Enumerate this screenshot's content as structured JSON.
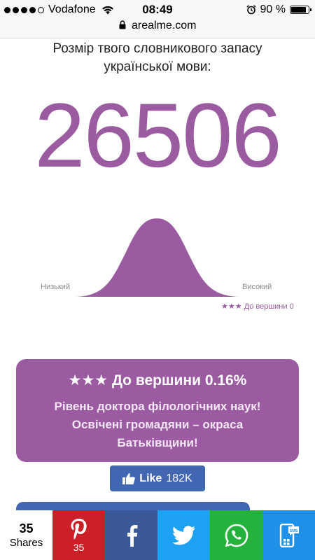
{
  "status_bar": {
    "carrier": "Vodafone",
    "time": "08:49",
    "battery_percent": "90 %",
    "signal_bars": 4,
    "battery_level": 0.9
  },
  "url_bar": {
    "domain": "arealme.com"
  },
  "result": {
    "subtitle": "Розмір твого словникового запасу української мови:",
    "score": "26506"
  },
  "curve": {
    "low_label": "Низький",
    "high_label": "Високий",
    "marker_label": "★★★ До вершини 0"
  },
  "result_card": {
    "title": "★★★ До вершини 0.16%",
    "text": "Рівень доктора філологічних наук! Освічені громадяни – окраса Батьківщини!"
  },
  "like_button": {
    "label": "Like",
    "count": "182K"
  },
  "share_bar": {
    "count": "35",
    "count_label": "Shares",
    "pinterest_count": "35",
    "sms_label": "SMS"
  },
  "colors": {
    "accent": "#9b5ba1",
    "facebook": "#3b5998",
    "pinterest": "#cb2027",
    "twitter": "#1da1f2",
    "whatsapp": "#25b23c",
    "sms": "#1e90e8"
  }
}
